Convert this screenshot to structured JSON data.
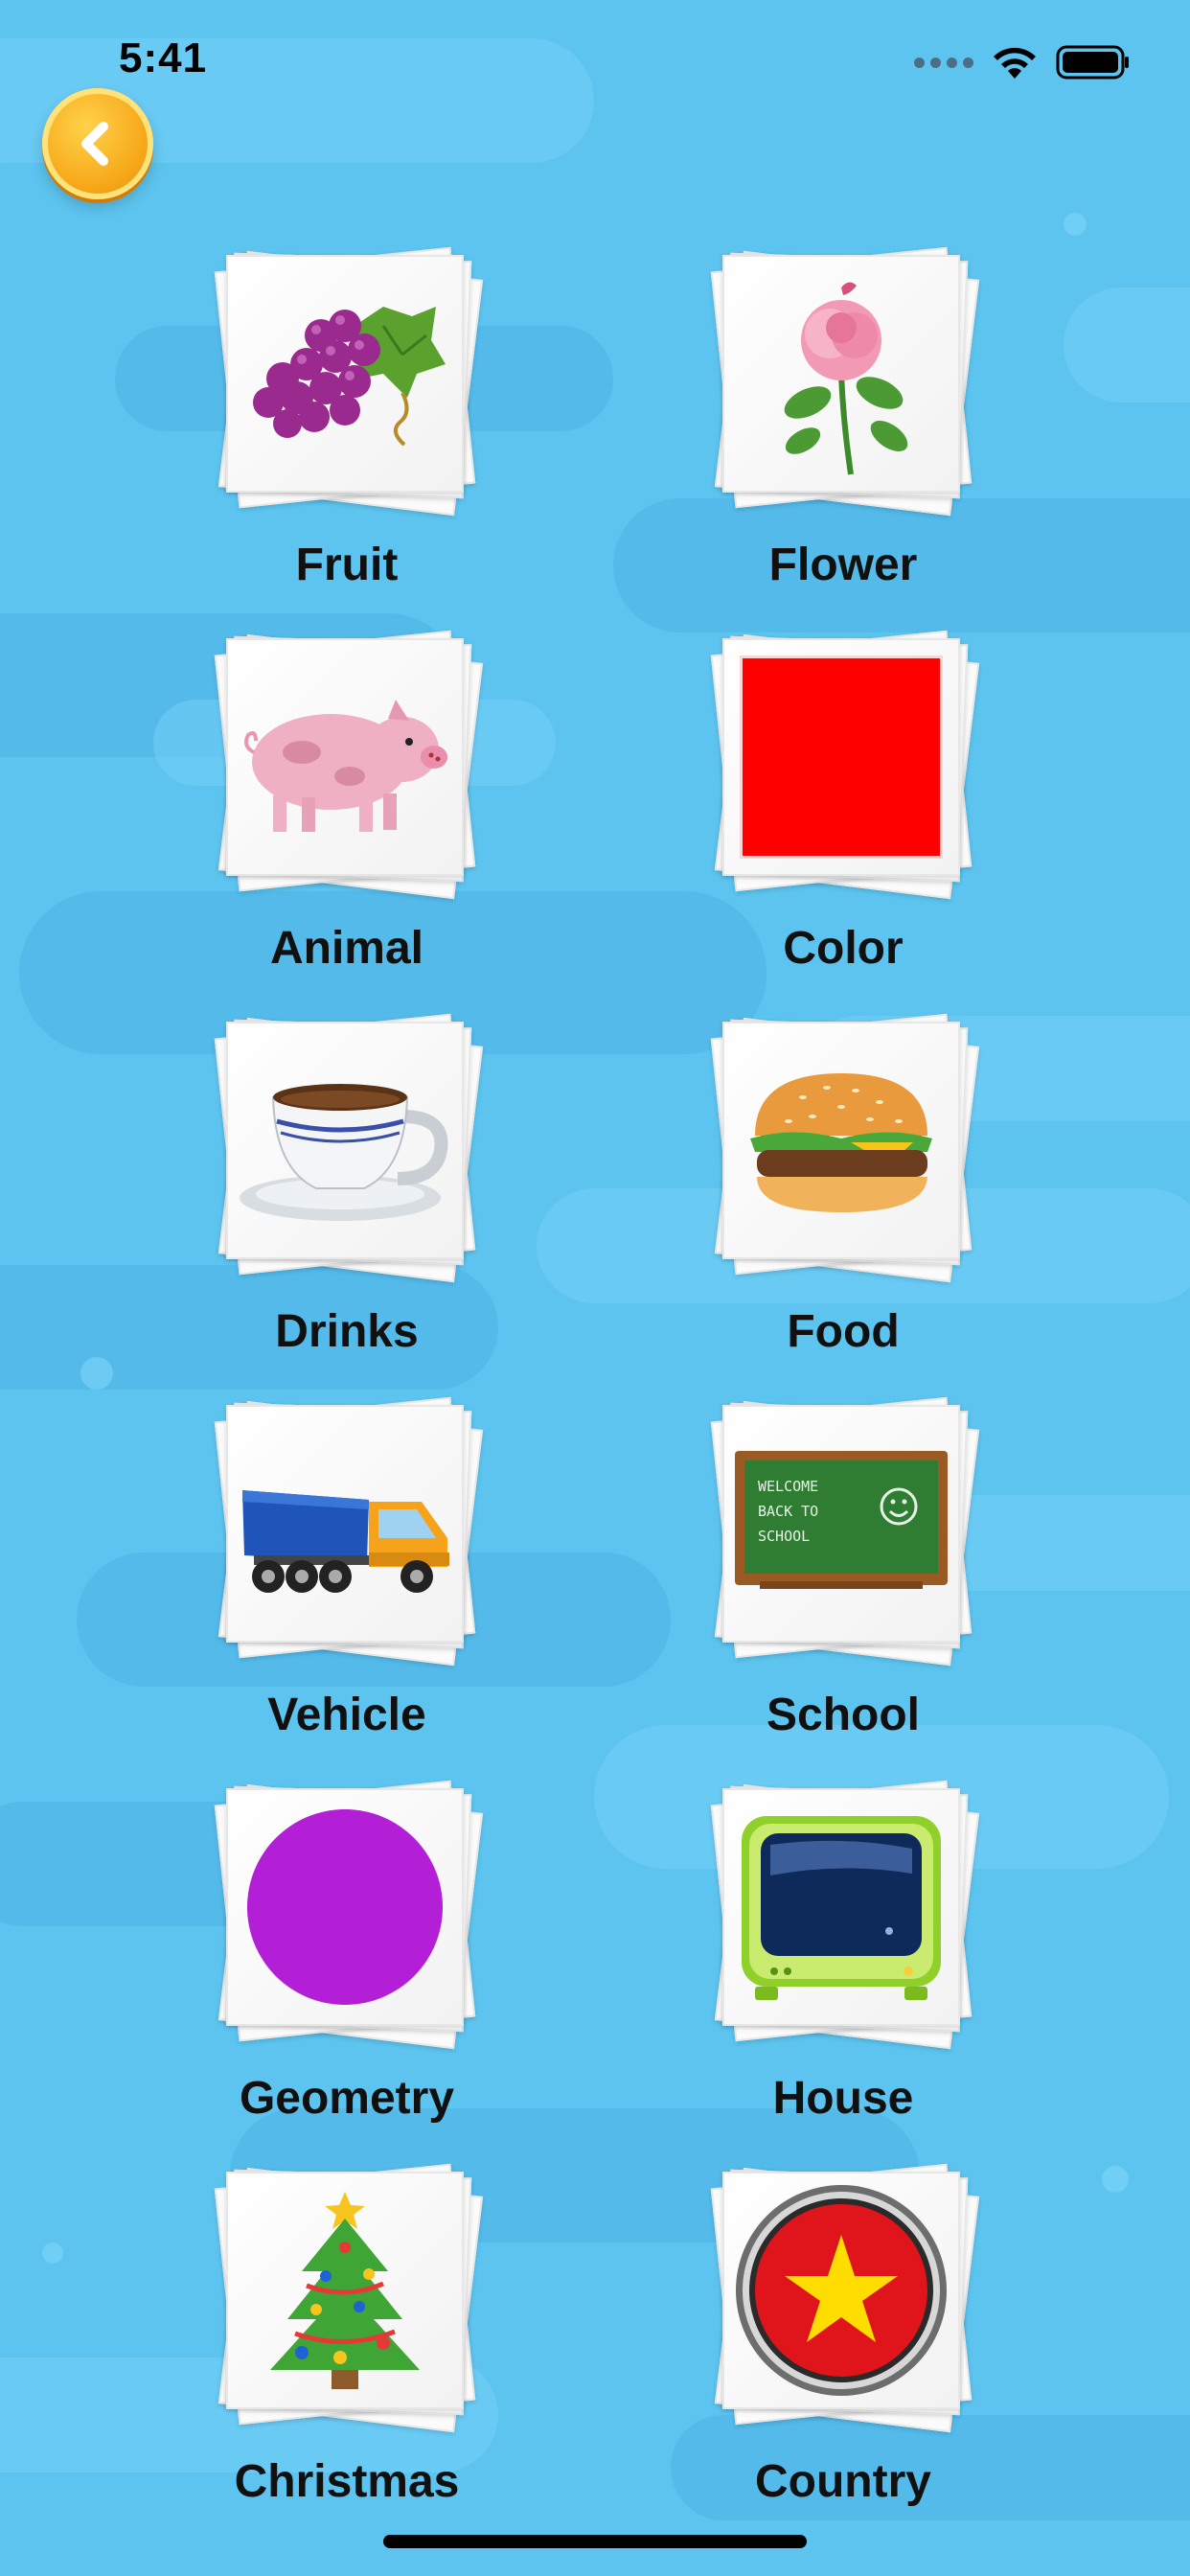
{
  "status_bar": {
    "time": "5:41"
  },
  "navigation": {
    "back_icon": "chevron-left-icon"
  },
  "categories": [
    {
      "label": "Fruit",
      "icon": "grapes-icon"
    },
    {
      "label": "Flower",
      "icon": "rose-icon"
    },
    {
      "label": "Animal",
      "icon": "pig-icon"
    },
    {
      "label": "Color",
      "icon": "red-square-icon",
      "color": "#ff0000"
    },
    {
      "label": "Drinks",
      "icon": "coffee-cup-icon"
    },
    {
      "label": "Food",
      "icon": "hamburger-icon"
    },
    {
      "label": "Vehicle",
      "icon": "truck-icon"
    },
    {
      "label": "School",
      "icon": "chalkboard-icon",
      "chalkboard_text": "WELCOME BACK TO SCHOOL"
    },
    {
      "label": "Geometry",
      "icon": "purple-circle-icon",
      "color": "#b21fd6"
    },
    {
      "label": "House",
      "icon": "television-icon"
    },
    {
      "label": "Christmas",
      "icon": "christmas-tree-icon"
    },
    {
      "label": "Country",
      "icon": "vietnam-flag-icon",
      "colors": [
        "#e0141b",
        "#ffdd00"
      ]
    }
  ],
  "colors": {
    "background": "#5cc4ef",
    "back_button": "#f7a81a"
  }
}
